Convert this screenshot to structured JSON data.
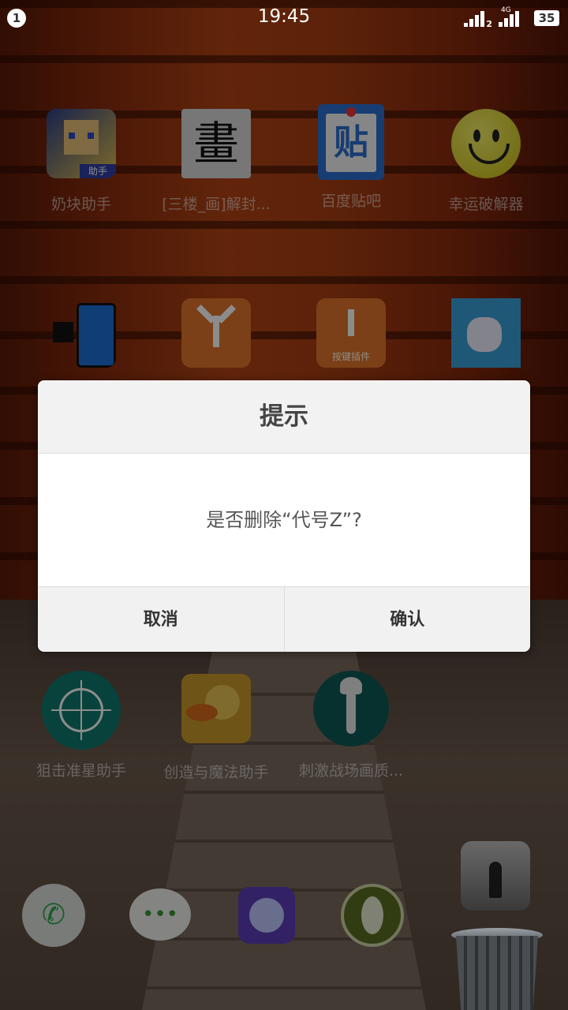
{
  "status_bar": {
    "notification_count": "1",
    "time": "19:45",
    "sim2_label": "2",
    "network_label": "4G",
    "battery": "35"
  },
  "apps_row1": [
    {
      "label": "奶块助手",
      "icon": "minecraft-character-icon",
      "badge": "助手"
    },
    {
      "label": "[三楼_画]解封...",
      "icon": "hua-character-icon",
      "glyph": "畫"
    },
    {
      "label": "百度贴吧",
      "icon": "baidu-tieba-icon",
      "glyph": "贴"
    },
    {
      "label": "幸运破解器",
      "icon": "smiley-face-icon"
    }
  ],
  "apps_row2": [
    {
      "label": "",
      "icon": "phone-transfer-icon"
    },
    {
      "label": "",
      "icon": "y-shape-orange-icon"
    },
    {
      "label": "",
      "icon": "y-shape-plugin-icon",
      "badge": "按键插件"
    },
    {
      "label": "",
      "icon": "cat-icon"
    }
  ],
  "apps_row3": [
    {
      "label": "狙击准星助手",
      "icon": "crosshair-icon"
    },
    {
      "label": "创造与魔法助手",
      "icon": "bird-icon"
    },
    {
      "label": "刺激战场画质...",
      "icon": "wrench-icon"
    }
  ],
  "dialog": {
    "title": "提示",
    "message": "是否删除“代号Z”?",
    "cancel": "取消",
    "confirm": "确认"
  },
  "dock": [
    "phone-icon",
    "message-icon",
    "browser-globe-icon",
    "shoe-sole-icon"
  ],
  "dragged_app": "person-in-fog-icon",
  "trash": "trash-can-icon",
  "colors": {
    "accent_teal": "#0e7a6e",
    "dialog_bg": "#fafafa",
    "wallpaper_orange": "#b24415"
  }
}
